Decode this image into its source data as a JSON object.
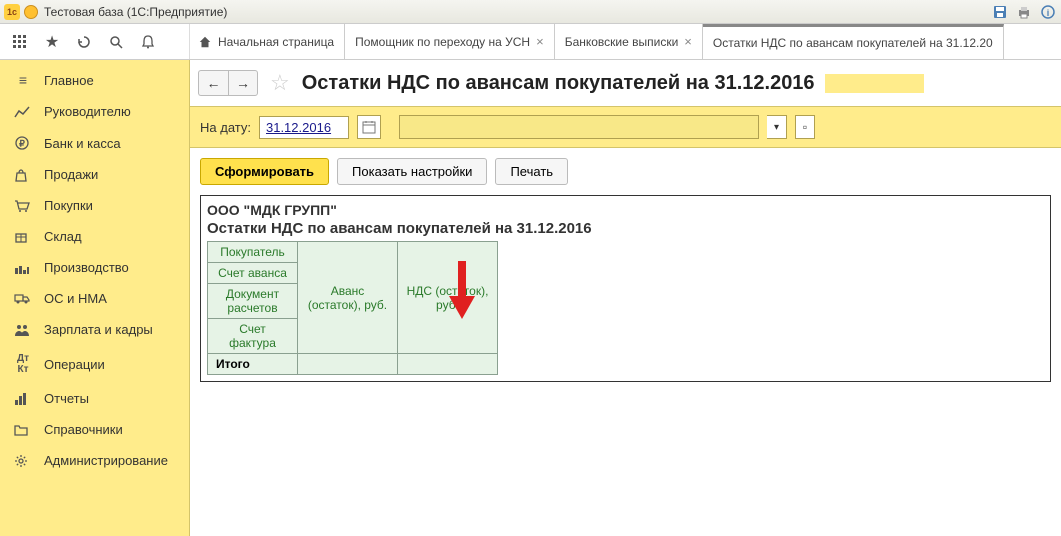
{
  "titlebar": {
    "text": "Тестовая база  (1С:Предприятие)"
  },
  "tabs": {
    "home": "Начальная страница",
    "t1": "Помощник по переходу на УСН",
    "t2": "Банковские выписки",
    "t3": "Остатки НДС по авансам покупателей на 31.12.20"
  },
  "sidebar": {
    "items": [
      {
        "label": "Главное"
      },
      {
        "label": "Руководителю"
      },
      {
        "label": "Банк и касса"
      },
      {
        "label": "Продажи"
      },
      {
        "label": "Покупки"
      },
      {
        "label": "Склад"
      },
      {
        "label": "Производство"
      },
      {
        "label": "ОС и НМА"
      },
      {
        "label": "Зарплата и кадры"
      },
      {
        "label": "Операции"
      },
      {
        "label": "Отчеты"
      },
      {
        "label": "Справочники"
      },
      {
        "label": "Администрирование"
      }
    ]
  },
  "page": {
    "title": "Остатки НДС по авансам покупателей на 31.12.2016"
  },
  "filter": {
    "date_label": "На дату:",
    "date_value": "31.12.2016"
  },
  "actions": {
    "generate": "Сформировать",
    "settings": "Показать настройки",
    "print": "Печать"
  },
  "report": {
    "org": "ООО \"МДК ГРУПП\"",
    "title": "Остатки НДС по авансам покупателей на 31.12.2016",
    "headers": {
      "c1a": "Покупатель",
      "c1b": "Счет аванса",
      "c1c": "Документ расчетов",
      "c1d": "Счет фактура",
      "c2": "Аванс (остаток), руб.",
      "c3": "НДС (остаток), руб.",
      "total": "Итого"
    }
  }
}
